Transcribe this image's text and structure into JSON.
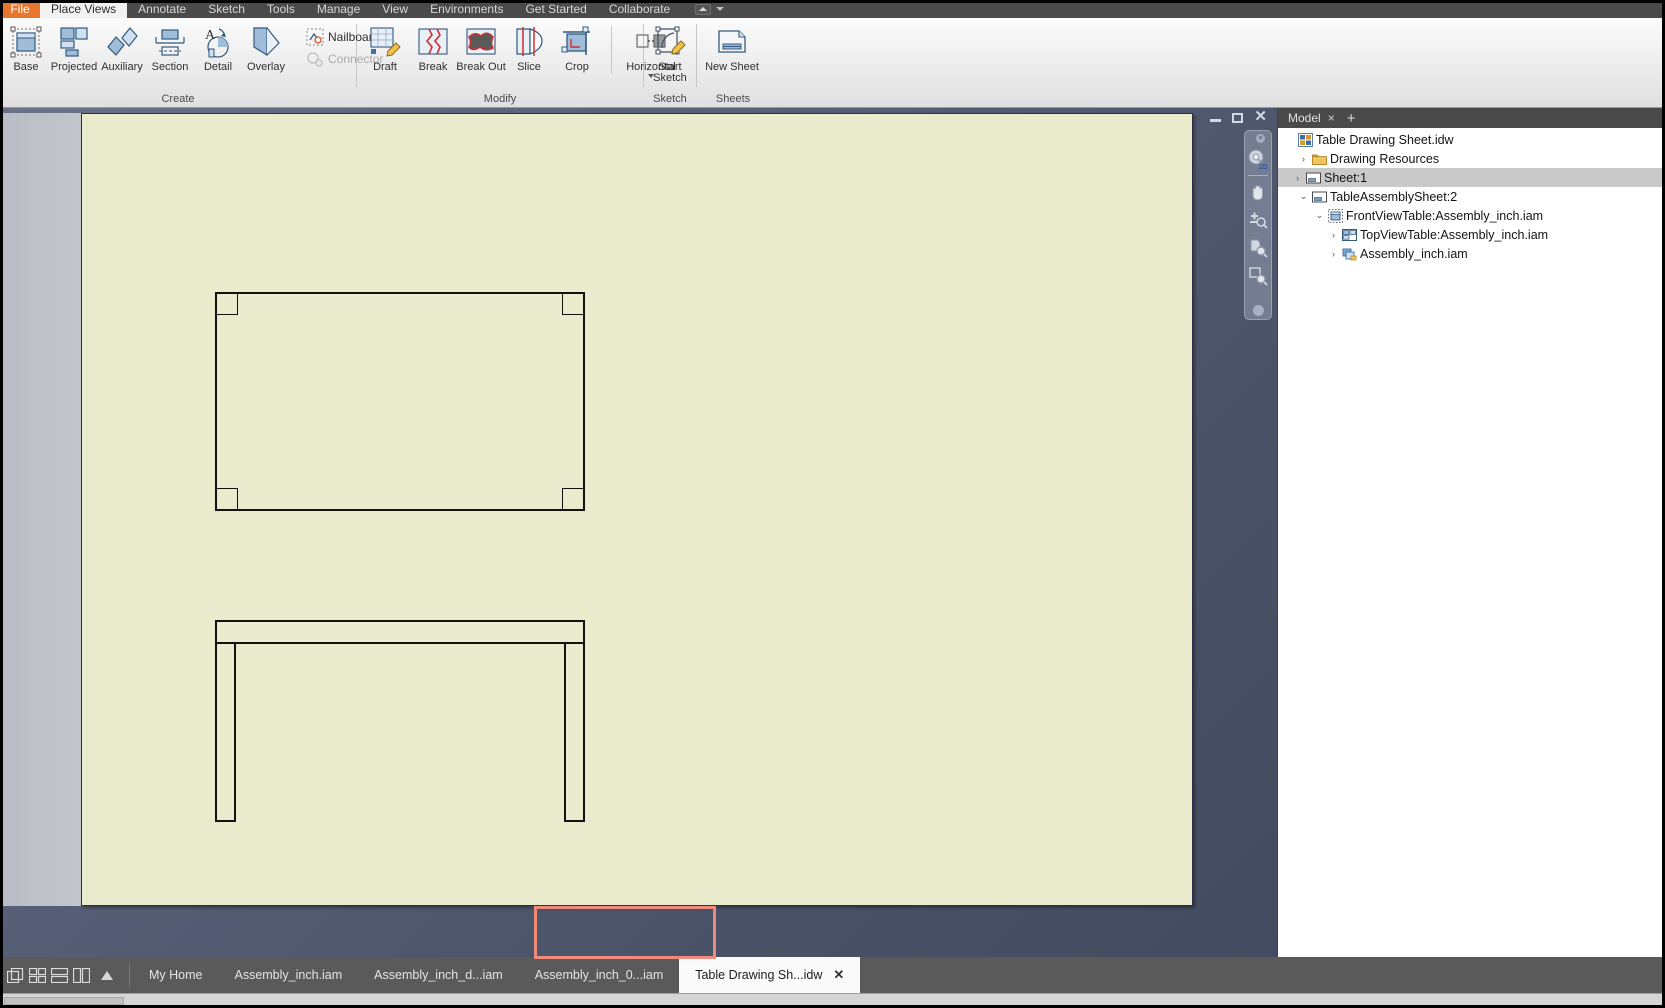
{
  "ribbon": {
    "file_tab": "File",
    "tabs": [
      {
        "label": "Place Views",
        "active": true
      },
      {
        "label": "Annotate",
        "active": false
      },
      {
        "label": "Sketch",
        "active": false
      },
      {
        "label": "Tools",
        "active": false
      },
      {
        "label": "Manage",
        "active": false
      },
      {
        "label": "View",
        "active": false
      },
      {
        "label": "Environments",
        "active": false
      },
      {
        "label": "Get Started",
        "active": false
      },
      {
        "label": "Collaborate",
        "active": false
      }
    ],
    "groups": [
      {
        "title": "Create",
        "large_buttons": [
          {
            "label": "Base",
            "icon": "base-view-icon"
          },
          {
            "label": "Projected",
            "icon": "projected-view-icon"
          },
          {
            "label": "Auxiliary",
            "icon": "auxiliary-view-icon"
          },
          {
            "label": "Section",
            "icon": "section-view-icon"
          },
          {
            "label": "Detail",
            "icon": "detail-view-icon"
          },
          {
            "label": "Overlay",
            "icon": "overlay-view-icon"
          }
        ],
        "small_buttons": [
          {
            "label": "Nailboard",
            "icon": "nailboard-icon",
            "disabled": false
          },
          {
            "label": "Connector",
            "icon": "connector-icon",
            "disabled": true
          }
        ]
      },
      {
        "title": "Modify",
        "large_buttons": [
          {
            "label": "Draft",
            "icon": "draft-icon"
          },
          {
            "label": "Break",
            "icon": "break-icon"
          },
          {
            "label": "Break Out",
            "icon": "break-out-icon"
          },
          {
            "label": "Slice",
            "icon": "slice-icon"
          },
          {
            "label": "Crop",
            "icon": "crop-icon"
          }
        ],
        "large_buttons_2": [
          {
            "label": "Horizontal",
            "icon": "horizontal-align-icon",
            "has_dropdown": true
          }
        ]
      },
      {
        "title": "Sketch",
        "large_buttons": [
          {
            "label": "Start Sketch",
            "icon": "start-sketch-icon"
          }
        ]
      },
      {
        "title": "Sheets",
        "large_buttons": [
          {
            "label": "New Sheet",
            "icon": "new-sheet-icon"
          }
        ]
      }
    ]
  },
  "window_controls": {
    "minimize": "minimize-icon",
    "restore": "restore-icon",
    "close": "close-icon"
  },
  "navbar": {
    "close_label": "×",
    "tools": [
      {
        "name": "steering-wheel-2d-icon",
        "label": "Full Navigation Wheel 2D"
      },
      {
        "name": "pan-hand-icon",
        "label": "Pan"
      },
      {
        "name": "zoom-icon",
        "label": "Zoom"
      },
      {
        "name": "zoom-all-icon",
        "label": "Zoom All"
      },
      {
        "name": "zoom-window-icon",
        "label": "Zoom Window"
      }
    ]
  },
  "browser": {
    "tab_label": "Model",
    "tab_close": "×",
    "add_tab": "+",
    "tree": [
      {
        "label": "Table Drawing Sheet.idw",
        "indent": 0,
        "twisty": "",
        "icon": "document-idw-icon",
        "selected": false
      },
      {
        "label": "Drawing Resources",
        "indent": 1,
        "twisty": "›",
        "icon": "folder-icon",
        "selected": false
      },
      {
        "label": "Sheet:1",
        "indent": 1,
        "twisty": "›",
        "icon": "sheet-icon",
        "selected": true
      },
      {
        "label": "TableAssemblySheet:2",
        "indent": 1,
        "twisty": "⌄",
        "icon": "sheet-icon",
        "selected": false
      },
      {
        "label": "FrontViewTable:Assembly_inch.iam",
        "indent": 2,
        "twisty": "⌄",
        "icon": "base-view-node-icon",
        "selected": false
      },
      {
        "label": "TopViewTable:Assembly_inch.iam",
        "indent": 3,
        "twisty": "›",
        "icon": "projected-view-node-icon",
        "selected": false
      },
      {
        "label": "Assembly_inch.iam",
        "indent": 3,
        "twisty": "›",
        "icon": "assembly-icon",
        "selected": false
      }
    ]
  },
  "taskbar": {
    "arrange_icons": [
      {
        "name": "cascade-windows-icon"
      },
      {
        "name": "tile-windows-icon"
      },
      {
        "name": "tile-horizontal-icon"
      },
      {
        "name": "tile-vertical-icon"
      }
    ],
    "expand_icon": "chevron-up-icon",
    "documents": [
      {
        "label": "My Home",
        "active": false,
        "closable": false
      },
      {
        "label": "Assembly_inch.iam",
        "active": false,
        "closable": false
      },
      {
        "label": "Assembly_inch_d...iam",
        "active": false,
        "closable": false
      },
      {
        "label": "Assembly_inch_0...iam",
        "active": false,
        "closable": false
      },
      {
        "label": "Table Drawing Sh...idw",
        "active": true,
        "closable": true,
        "close_glyph": "✕"
      }
    ]
  },
  "drawing": {
    "sheet_background": "#eaeacd",
    "line_color": "#111111",
    "top_view": {
      "name": "TopViewTable",
      "label": "table top plan view"
    },
    "front_view": {
      "name": "FrontViewTable",
      "label": "table front elevation"
    }
  },
  "colors": {
    "file_tab_orange": "#e8762c",
    "ribbon_dark": "#4a4a4a",
    "canvas_blue": "#4d566b",
    "highlight_red": "#ef8a7c",
    "selection_grey": "#c9c9c9"
  }
}
